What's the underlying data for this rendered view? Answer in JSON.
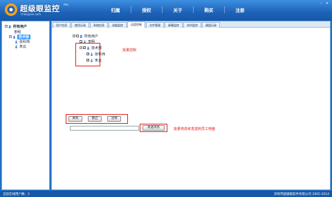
{
  "header": {
    "logo_text": "超级眼监控",
    "logo_sup": "PRO",
    "logo_sub": "chaojiyan.com",
    "nav": [
      "归属",
      "授权",
      "关于",
      "购买",
      "注册"
    ]
  },
  "tree": {
    "root_label": "所有用户",
    "items": [
      {
        "label": "李明",
        "level": 1
      },
      {
        "label": "技术部",
        "level": 1,
        "selected": true
      },
      {
        "label": "张科玮",
        "level": 2
      },
      {
        "label": "朱云",
        "level": 2
      }
    ]
  },
  "tabs": [
    "用户信息",
    "使用记录",
    "系统信息",
    "流量监控",
    "远程控制",
    "文件管理",
    "屏幕监控",
    "实时监控",
    "键盘记录"
  ],
  "active_tab_index": 4,
  "remote_tree": {
    "root": "所有用户",
    "child1": "李明",
    "child2": "技术部",
    "grandchildren": [
      "张科玮",
      "朱云"
    ]
  },
  "annotations": {
    "batch_control": "批量控制",
    "send_file": "批量将成考发送到员工电脑"
  },
  "buttons": {
    "shutdown": "关机",
    "restart": "重启",
    "logout": "注销",
    "send": "发送消息"
  },
  "message_input": {
    "value": ""
  },
  "status": {
    "left": "当前在线用户数：2",
    "right": "深圳市超级眼软件有限公司 2005-2014"
  },
  "colors": {
    "accent": "#1d62b8",
    "annotation": "#e02020"
  }
}
